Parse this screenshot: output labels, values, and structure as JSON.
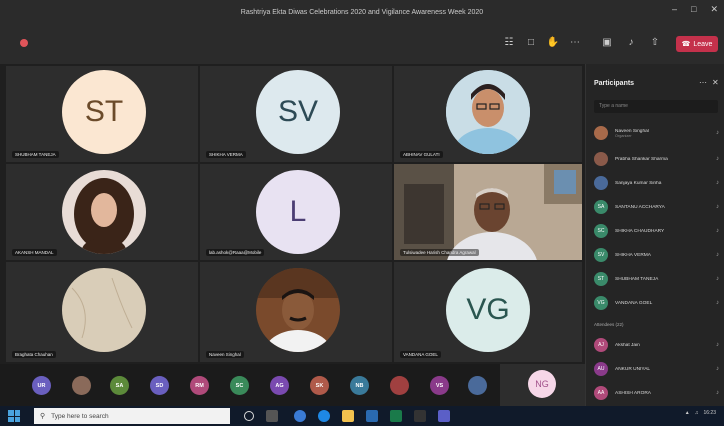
{
  "window": {
    "title": "Rashtriya Ekta Diwas Celebrations 2020 and Vigilance Awareness Week 2020",
    "controls": [
      "–",
      "□",
      "✕"
    ]
  },
  "toolbar": {
    "leave_label": "Leave"
  },
  "tiles": [
    {
      "initials": "ST",
      "name": "SHUBHAM TANEJA",
      "bg": "#fbe7d2",
      "fg": "#6b4b2a"
    },
    {
      "initials": "SV",
      "name": "SHIKHA VERMA",
      "bg": "#dde9ee",
      "fg": "#2d4a55"
    },
    {
      "initials": "",
      "name": "ABHINAV GULATI",
      "photo": true
    },
    {
      "initials": "",
      "name": "AKANSH MANDAL",
      "photo": true
    },
    {
      "initials": "L",
      "name": "lab.ashok@Raaa@Mobile",
      "bg": "#e8e2f2",
      "fg": "#4b3d73"
    },
    {
      "initials": "",
      "name": "Tulsiwadee Harish Chandra Agrawal",
      "video": true
    },
    {
      "initials": "",
      "name": "Braghata Chauhan",
      "photo": true
    },
    {
      "initials": "",
      "name": "Naveen Singhal",
      "photo": true
    },
    {
      "initials": "VG",
      "name": "VANDANA GOEL",
      "bg": "#dbecea",
      "fg": "#2a5650"
    }
  ],
  "strip": [
    {
      "label": "UR",
      "color": "#6a5fbf"
    },
    {
      "label": "",
      "color": "#8a6a5a"
    },
    {
      "label": "SA",
      "color": "#5c8a3a"
    },
    {
      "label": "SD",
      "color": "#6a5fbf"
    },
    {
      "label": "RM",
      "color": "#b04a7a"
    },
    {
      "label": "SC",
      "color": "#3a8a5a"
    },
    {
      "label": "AG",
      "color": "#7a4ab0"
    },
    {
      "label": "SK",
      "color": "#b05a4a"
    },
    {
      "label": "NB",
      "color": "#3a7a9a"
    },
    {
      "label": "",
      "color": "#a04040"
    },
    {
      "label": "VS",
      "color": "#8a3a8a"
    },
    {
      "label": "",
      "color": "#4a6a9a"
    }
  ],
  "strip_tile": {
    "initials": "NG",
    "bg": "#f6d7e8",
    "fg": "#a0508a"
  },
  "panel": {
    "title": "Participants",
    "search_placeholder": "Type a name",
    "attendees_label": "Attendees (22)",
    "presenters": [
      {
        "name": "Naveen Singhal",
        "sub": "Organizer",
        "color": "#a86a4a",
        "initials": ""
      },
      {
        "name": "Prabha Shankar Sharma",
        "sub": "",
        "color": "#8a5a4a",
        "initials": ""
      },
      {
        "name": "Sanjaya Kumar Sinha",
        "sub": "",
        "color": "#4a6a9a",
        "initials": ""
      },
      {
        "name": "SANTANU ACCHARYA",
        "sub": "",
        "color": "#3a8a6a",
        "initials": "SA"
      },
      {
        "name": "SHIKHA CHAUDHARY",
        "sub": "",
        "color": "#3a8a6a",
        "initials": "SC"
      },
      {
        "name": "SHIKHA VERMA",
        "sub": "",
        "color": "#3a8a6a",
        "initials": "SV"
      },
      {
        "name": "SHUBHAM TANEJA",
        "sub": "",
        "color": "#3a8a6a",
        "initials": "ST"
      },
      {
        "name": "VANDANA GOEL",
        "sub": "",
        "color": "#3a8a6a",
        "initials": "VG"
      }
    ],
    "attendees": [
      {
        "name": "Akshat Jain",
        "color": "#b04a7a",
        "initials": "AJ"
      },
      {
        "name": "ANKUR UNIYAL",
        "color": "#8a3a8a",
        "initials": "AU"
      },
      {
        "name": "ASHISH ARORA",
        "color": "#b04a7a",
        "initials": "AA"
      }
    ]
  },
  "taskbar": {
    "search_placeholder": "Type here to search",
    "time": "16:23"
  }
}
